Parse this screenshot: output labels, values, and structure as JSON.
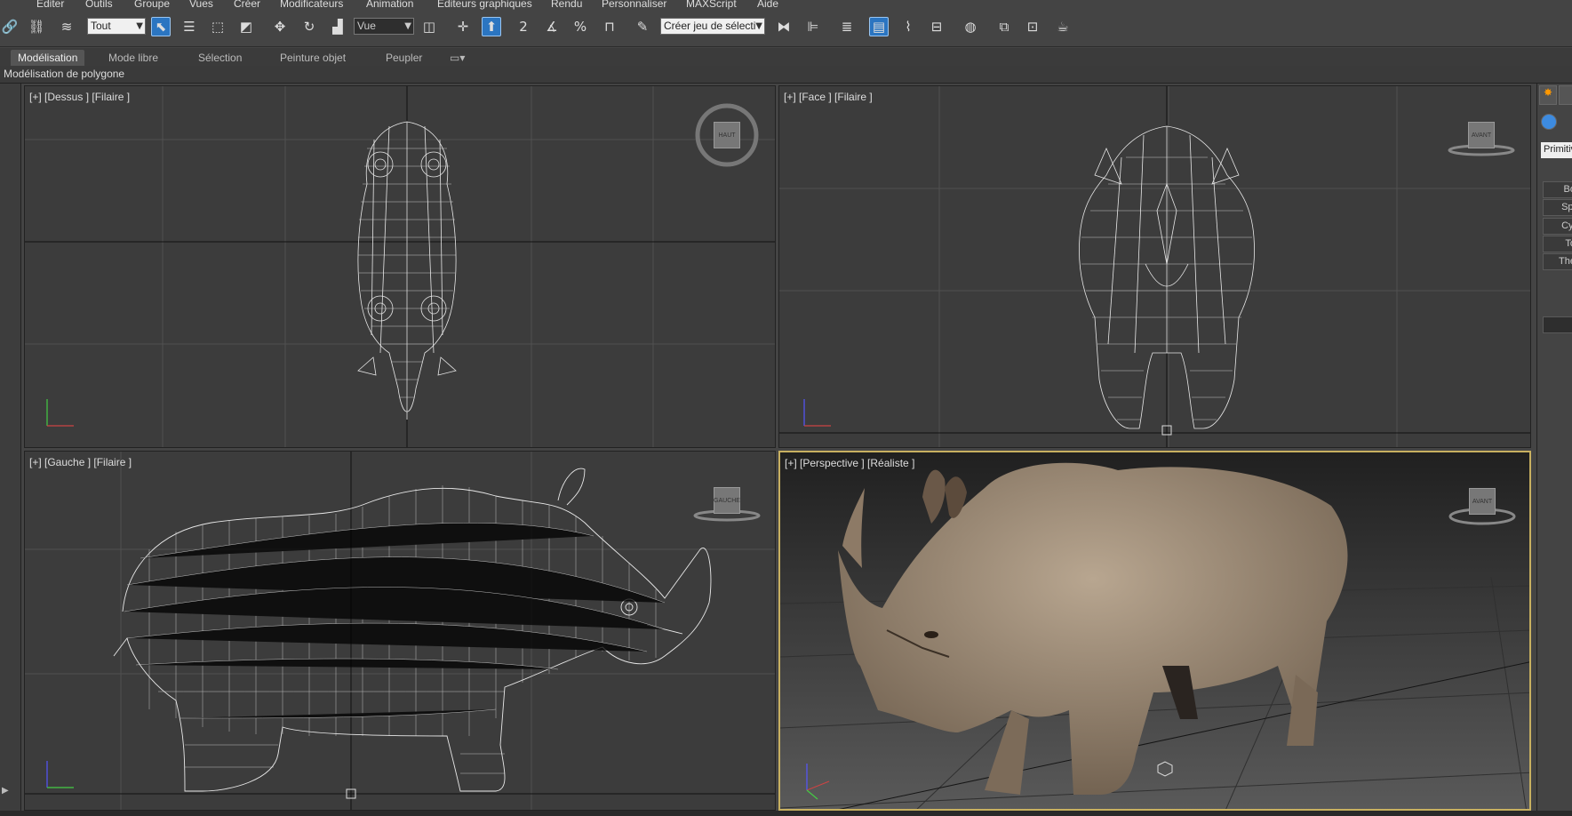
{
  "menu": [
    "Editer",
    "Outils",
    "Groupe",
    "Vues",
    "Créer",
    "Modificateurs",
    "Animation",
    "Editeurs graphiques",
    "Rendu",
    "Personnaliser",
    "MAXScript",
    "Aide"
  ],
  "toolbar": {
    "filter_value": "Tout",
    "refcoord_value": "Vue",
    "selection_set_placeholder": "Créer jeu de sélecti",
    "snap_label": "2",
    "snap3_label": "3",
    "percent_label": "%"
  },
  "ribbon": {
    "tabs": [
      "Modélisation",
      "Mode libre",
      "Sélection",
      "Peinture objet",
      "Peupler"
    ],
    "panel_label": "Modélisation de polygone"
  },
  "viewports": {
    "top": {
      "label": "[+] [Dessus ] [Filaire ]",
      "navcube": "HAUT"
    },
    "front": {
      "label": "[+] [Face ] [Filaire ]",
      "navcube": "AVANT"
    },
    "left": {
      "label": "[+] [Gauche ] [Filaire ]",
      "navcube": "GAUCHE"
    },
    "perspective": {
      "label": "[+] [Perspective ] [Réaliste ]",
      "navcube": "AVANT"
    }
  },
  "command_panel": {
    "dropdown": "Primitiv",
    "buttons": [
      "Bo",
      "Spl",
      "Cyl",
      "To",
      "The"
    ]
  },
  "colors": {
    "background": "#444444",
    "viewport": "#3c3c3c",
    "active_border": "#c8b060",
    "accent": "#2b75c1",
    "wire": "#e8e8e8",
    "rhino_skin": "#9a8670"
  }
}
